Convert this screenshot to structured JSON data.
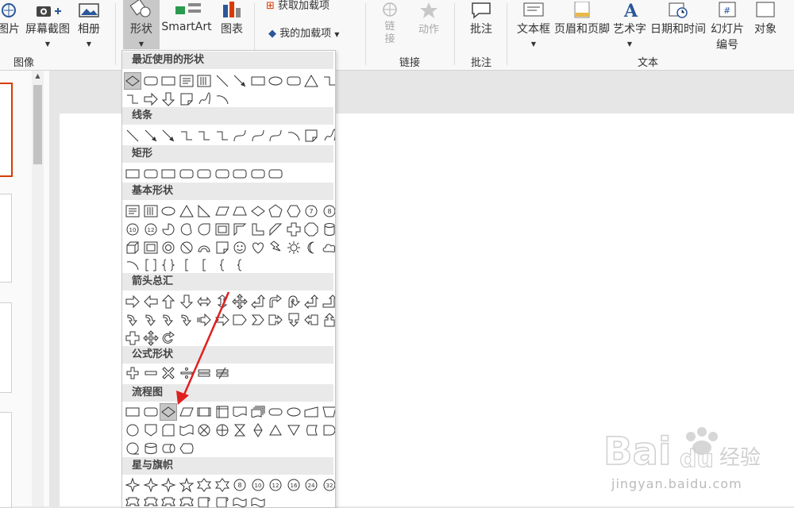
{
  "ribbon": {
    "image_group": {
      "picture": "图片",
      "screenshot": "屏幕截图",
      "album": "相册",
      "label": "图像"
    },
    "illustrations": {
      "shapes": "形状",
      "smartart": "SmartArt",
      "chart": "图表"
    },
    "addins": {
      "get": "获取加载项",
      "my": "我的加载项"
    },
    "links_group": {
      "link": "链接",
      "action": "动作",
      "label": "链接"
    },
    "comments_group": {
      "comment": "批注",
      "label": "批注"
    },
    "text_group": {
      "textbox": "文本框",
      "header_footer": "页眉和页脚",
      "wordart": "艺术字",
      "datetime": "日期和时间",
      "slide_number_1": "幻灯片",
      "slide_number_2": "编号",
      "object": "对象",
      "label": "文本"
    }
  },
  "shapes_menu": {
    "sections": [
      "最近使用的形状",
      "线条",
      "矩形",
      "基本形状",
      "箭头总汇",
      "公式形状",
      "流程图",
      "星与旗帜"
    ]
  },
  "watermark": {
    "brand": "Bai",
    "brand2": "du",
    "cn": "经验",
    "url": "jingyan.baidu.com"
  },
  "colors": {
    "accent_red": "#d83b01",
    "arrow_red": "#e02020"
  }
}
